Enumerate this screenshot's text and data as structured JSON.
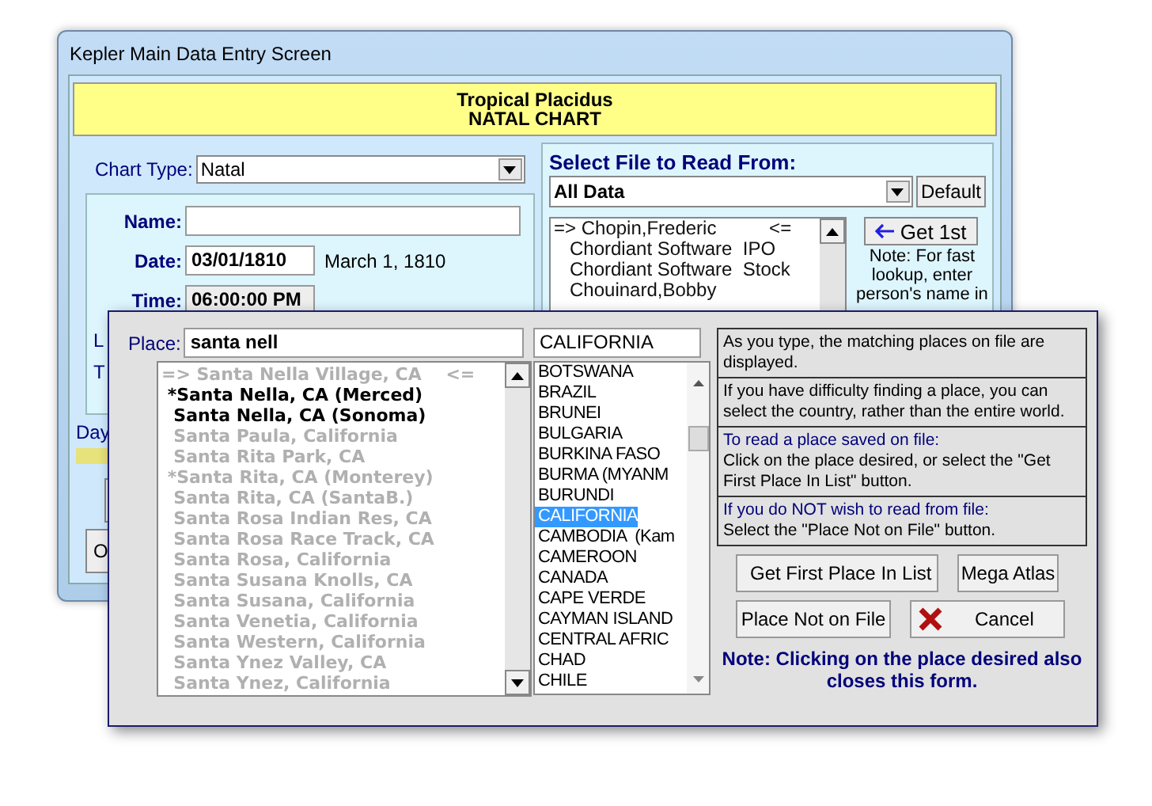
{
  "main_window": {
    "title": "Kepler Main Data Entry Screen",
    "banner": {
      "line_1": "Tropical  Placidus",
      "line_2": "NATAL CHART"
    },
    "chart_type": {
      "label": "Chart Type:",
      "value": "Natal"
    },
    "name": {
      "label": "Name:"
    },
    "date": {
      "label": "Date:",
      "value": "03/01/1810",
      "spelled": "March 1, 1810"
    },
    "time": {
      "label": "Time:",
      "value": "06:00:00 PM"
    },
    "partial_labels": [
      "L",
      "T"
    ],
    "day_label": "Day",
    "partial_button": "O",
    "file_panel": {
      "title": "Select File to Read From:",
      "file": "All Data",
      "default_button": "Default",
      "records": [
        {
          "text": "=> Chopin,Frederic          <="
        },
        {
          "text": "   Chordiant Software  IPO"
        },
        {
          "text": "   Chordiant Software  Stock"
        },
        {
          "text": "   Chouinard,Bobby"
        }
      ],
      "get_first_button": "Get 1st",
      "note_lines": [
        "Note: For fast",
        "lookup, enter",
        "person's name in"
      ]
    }
  },
  "place_dialog": {
    "place": {
      "label": "Place:",
      "value": "santa nell"
    },
    "places": [
      {
        "text": "=> Santa Nella Village, CA    <=",
        "matched": false
      },
      {
        "text": " *Santa Nella, CA (Merced)",
        "matched": true
      },
      {
        "text": "  Santa Nella, CA (Sonoma)",
        "matched": true
      },
      {
        "text": "  Santa Paula, California",
        "matched": false
      },
      {
        "text": "  Santa Rita Park, CA",
        "matched": false
      },
      {
        "text": " *Santa Rita, CA (Monterey)",
        "matched": false
      },
      {
        "text": "  Santa Rita, CA (SantaB.)",
        "matched": false
      },
      {
        "text": "  Santa Rosa Indian Res, CA",
        "matched": false
      },
      {
        "text": "  Santa Rosa Race Track, CA",
        "matched": false
      },
      {
        "text": "  Santa Rosa, California",
        "matched": false
      },
      {
        "text": "  Santa Susana Knolls, CA",
        "matched": false
      },
      {
        "text": "  Santa Susana, California",
        "matched": false
      },
      {
        "text": "  Santa Venetia, California",
        "matched": false
      },
      {
        "text": "  Santa Western, California",
        "matched": false
      },
      {
        "text": "  Santa Ynez Valley, CA",
        "matched": false
      },
      {
        "text": "  Santa Ynez, California",
        "matched": false
      }
    ],
    "country_field": "CALIFORNIA",
    "countries": [
      {
        "text": "BOTSWANA",
        "selected": false
      },
      {
        "text": "BRAZIL",
        "selected": false
      },
      {
        "text": "BRUNEI",
        "selected": false
      },
      {
        "text": "BULGARIA",
        "selected": false
      },
      {
        "text": "BURKINA FASO",
        "selected": false
      },
      {
        "text": "BURMA (MYANM",
        "selected": false
      },
      {
        "text": "BURUNDI",
        "selected": false
      },
      {
        "text": "CALIFORNIA",
        "selected": true
      },
      {
        "text": "CAMBODIA  (Kam",
        "selected": false
      },
      {
        "text": "CAMEROON",
        "selected": false
      },
      {
        "text": "CANADA",
        "selected": false
      },
      {
        "text": "CAPE VERDE",
        "selected": false
      },
      {
        "text": "CAYMAN ISLAND",
        "selected": false
      },
      {
        "text": "CENTRAL AFRIC",
        "selected": false
      },
      {
        "text": "CHAD",
        "selected": false
      },
      {
        "text": "CHILE",
        "selected": false
      }
    ],
    "help": [
      {
        "heading": "As you type, the matching places on file are displayed."
      },
      {
        "heading": "If you have difficulty finding a place, you can select the country, rather than the entire world."
      },
      {
        "title": "To read a place saved on file:",
        "body": "Click on the place desired, or select the \"Get First Place In List\" button."
      },
      {
        "title": "If you do NOT wish to read from file:",
        "body": "Select the \"Place Not on File\" button."
      }
    ],
    "get_first_button": "Get First Place In List",
    "mega_atlas_button": "Mega Atlas",
    "not_on_file_button": "Place Not on File",
    "cancel_button": "Cancel",
    "note": "Note: Clicking on the place desired also closes this form."
  }
}
